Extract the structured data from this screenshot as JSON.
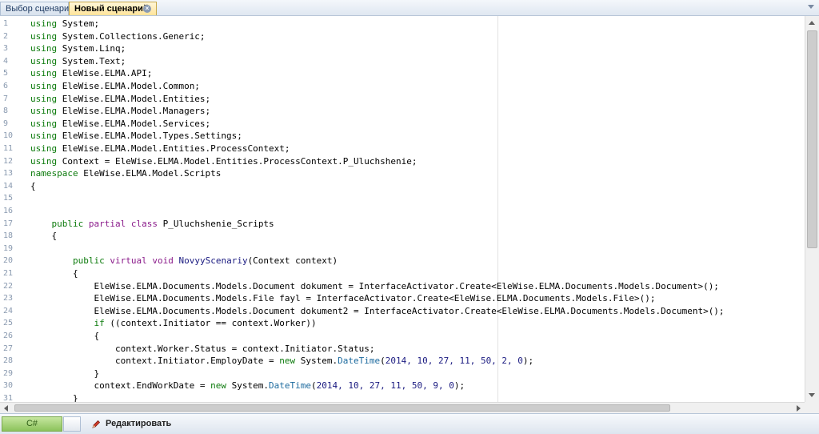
{
  "tabs": [
    {
      "label": "Выбор сценария",
      "active": false
    },
    {
      "label": "Новый сценарий",
      "active": true
    }
  ],
  "tab_close_icon": "close-icon",
  "code": {
    "line_numbers": [
      "1",
      "2",
      "3",
      "4",
      "5",
      "6",
      "7",
      "8",
      "9",
      "10",
      "11",
      "12",
      "13",
      "14",
      "15",
      "16",
      "17",
      "18",
      "19",
      "20",
      "21",
      "22",
      "23",
      "24",
      "25",
      "26",
      "27",
      "28",
      "29",
      "30",
      "31"
    ],
    "lines": [
      [
        {
          "t": "using",
          "c": "kw"
        },
        {
          "t": " System;"
        }
      ],
      [
        {
          "t": "using",
          "c": "kw"
        },
        {
          "t": " System.Collections.Generic;"
        }
      ],
      [
        {
          "t": "using",
          "c": "kw"
        },
        {
          "t": " System.Linq;"
        }
      ],
      [
        {
          "t": "using",
          "c": "kw"
        },
        {
          "t": " System.Text;"
        }
      ],
      [
        {
          "t": "using",
          "c": "kw"
        },
        {
          "t": " EleWise.ELMA.API;"
        }
      ],
      [
        {
          "t": "using",
          "c": "kw"
        },
        {
          "t": " EleWise.ELMA.Model.Common;"
        }
      ],
      [
        {
          "t": "using",
          "c": "kw"
        },
        {
          "t": " EleWise.ELMA.Model.Entities;"
        }
      ],
      [
        {
          "t": "using",
          "c": "kw"
        },
        {
          "t": " EleWise.ELMA.Model.Managers;"
        }
      ],
      [
        {
          "t": "using",
          "c": "kw"
        },
        {
          "t": " EleWise.ELMA.Model.Services;"
        }
      ],
      [
        {
          "t": "using",
          "c": "kw"
        },
        {
          "t": " EleWise.ELMA.Model.Types.Settings;"
        }
      ],
      [
        {
          "t": "using",
          "c": "kw"
        },
        {
          "t": " EleWise.ELMA.Model.Entities.ProcessContext;"
        }
      ],
      [
        {
          "t": "using",
          "c": "kw"
        },
        {
          "t": " Context = EleWise.ELMA.Model.Entities.ProcessContext.P_Uluchshenie;"
        }
      ],
      [
        {
          "t": "namespace",
          "c": "kw"
        },
        {
          "t": " EleWise.ELMA.Model.Scripts"
        }
      ],
      [
        {
          "t": "{"
        }
      ],
      [
        {
          "t": ""
        }
      ],
      [
        {
          "t": ""
        }
      ],
      [
        {
          "t": "    "
        },
        {
          "t": "public",
          "c": "kw"
        },
        {
          "t": " "
        },
        {
          "t": "partial",
          "c": "kwb"
        },
        {
          "t": " "
        },
        {
          "t": "class",
          "c": "kwb"
        },
        {
          "t": " P_Uluchshenie_Scripts"
        }
      ],
      [
        {
          "t": "    {"
        }
      ],
      [
        {
          "t": ""
        }
      ],
      [
        {
          "t": "        "
        },
        {
          "t": "public",
          "c": "kw"
        },
        {
          "t": " "
        },
        {
          "t": "virtual",
          "c": "kwb"
        },
        {
          "t": " "
        },
        {
          "t": "void",
          "c": "kwb"
        },
        {
          "t": " "
        },
        {
          "t": "NovyyScenariy",
          "c": "fn"
        },
        {
          "t": "(Context context)"
        }
      ],
      [
        {
          "t": "        {"
        }
      ],
      [
        {
          "t": "            EleWise.ELMA.Documents.Models.Document dokument = InterfaceActivator.Create<EleWise.ELMA.Documents.Models.Document>();"
        }
      ],
      [
        {
          "t": "            EleWise.ELMA.Documents.Models.File fayl = InterfaceActivator.Create<EleWise.ELMA.Documents.Models.File>();"
        }
      ],
      [
        {
          "t": "            EleWise.ELMA.Documents.Models.Document dokument2 = InterfaceActivator.Create<EleWise.ELMA.Documents.Models.Document>();"
        }
      ],
      [
        {
          "t": "            "
        },
        {
          "t": "if",
          "c": "kw"
        },
        {
          "t": " ((context.Initiator == context.Worker))"
        }
      ],
      [
        {
          "t": "            {"
        }
      ],
      [
        {
          "t": "                context.Worker.Status = context.Initiator.Status;"
        }
      ],
      [
        {
          "t": "                context.Initiator.EmployDate = "
        },
        {
          "t": "new",
          "c": "kw"
        },
        {
          "t": " System."
        },
        {
          "t": "DateTime",
          "c": "ty"
        },
        {
          "t": "("
        },
        {
          "t": "2014, 10, 27, 11, 50, 2, 0",
          "c": "num"
        },
        {
          "t": ");"
        }
      ],
      [
        {
          "t": "            }"
        }
      ],
      [
        {
          "t": "            context.EndWorkDate = "
        },
        {
          "t": "new",
          "c": "kw"
        },
        {
          "t": " System."
        },
        {
          "t": "DateTime",
          "c": "ty"
        },
        {
          "t": "("
        },
        {
          "t": "2014, 10, 27, 11, 50, 9, 0",
          "c": "num"
        },
        {
          "t": ");"
        }
      ],
      [
        {
          "t": "        }"
        }
      ]
    ]
  },
  "bottombar": {
    "language_label": "C#",
    "edit_label": "Редактировать",
    "edit_icon": "pencil-icon"
  }
}
